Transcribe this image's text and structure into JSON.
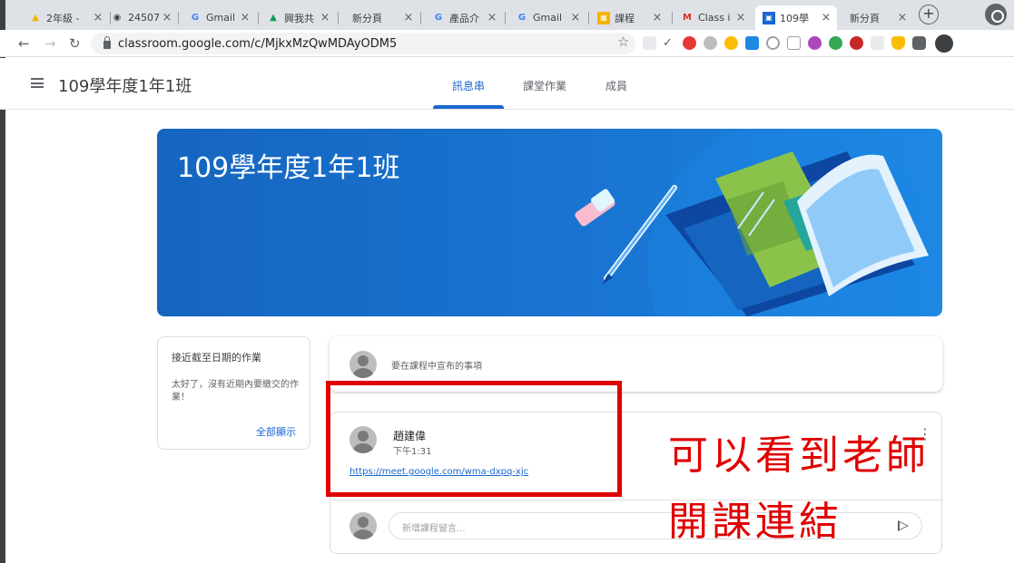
{
  "browser": {
    "tabs": [
      {
        "title": "2年級 -",
        "icon": "google-drive-icon"
      },
      {
        "title": "24507(",
        "icon": "globe-icon"
      },
      {
        "title": "Gmail",
        "icon": "google-icon"
      },
      {
        "title": "興我共",
        "icon": "google-drive-icon"
      },
      {
        "title": "新分頁",
        "icon": "none"
      },
      {
        "title": "產品介",
        "icon": "google-icon"
      },
      {
        "title": "Gmail",
        "icon": "google-icon"
      },
      {
        "title": "課程",
        "icon": "calendar-icon"
      },
      {
        "title": "Class i",
        "icon": "gmail-icon"
      },
      {
        "title": "109學",
        "icon": "classroom-icon"
      },
      {
        "title": "新分頁",
        "icon": "none"
      }
    ],
    "active_tab_index": 9,
    "url": "classroom.google.com/c/MjkxMzQwMDAyODM5"
  },
  "header": {
    "course_title": "109學年度1年1班",
    "tabs": [
      "訊息串",
      "課堂作業",
      "成員"
    ],
    "active_tab": "訊息串"
  },
  "banner": {
    "title": "109學年度1年1班",
    "colors": {
      "primary": "#1976d2"
    }
  },
  "upcoming": {
    "title": "接近截至日期的作業",
    "body": "太好了，沒有近期內要繳交的作業！",
    "view_all": "全部顯示"
  },
  "stream": {
    "announce_placeholder": "要在課程中宣布的事項",
    "post": {
      "author": "趙建偉",
      "time": "下午1:31",
      "link": "https://meet.google.com/wma-dxpq-xjc",
      "comment_placeholder": "新增課程留言..."
    }
  },
  "annotation": {
    "line1": "可以看到老師",
    "line2": "開課連結",
    "color": "#e00000"
  }
}
